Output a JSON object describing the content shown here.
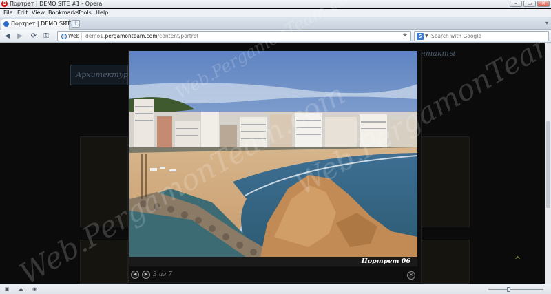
{
  "window": {
    "title": "Портрет | DEMO SITE #1 - Opera",
    "buttons": {
      "minimize": "–",
      "restore": "▭",
      "close": "✕"
    }
  },
  "menu": [
    "File",
    "Edit",
    "View",
    "Bookmarks",
    "Tools",
    "Help"
  ],
  "tab": {
    "label": "Портрет | DEMO SITE #1",
    "close": "×",
    "new_tab": "+"
  },
  "address_bar": {
    "chip": "Web",
    "url_prefix": "demo1.",
    "url_domain": "pergamonteam.com",
    "url_path": "/content/portret"
  },
  "search": {
    "engine_icon": "S",
    "placeholder": "Search with Google"
  },
  "site": {
    "menu_left": "Архитектур",
    "menu_right": "онтакты",
    "scroll_top": "⌃"
  },
  "lightbox": {
    "caption": "Портрет 06",
    "counter": "3 из 7",
    "prev": "◀",
    "next": "▶",
    "close": "✕"
  },
  "watermark": "Web.PergamonTeam.com",
  "zoom": {
    "level": 0.35
  }
}
